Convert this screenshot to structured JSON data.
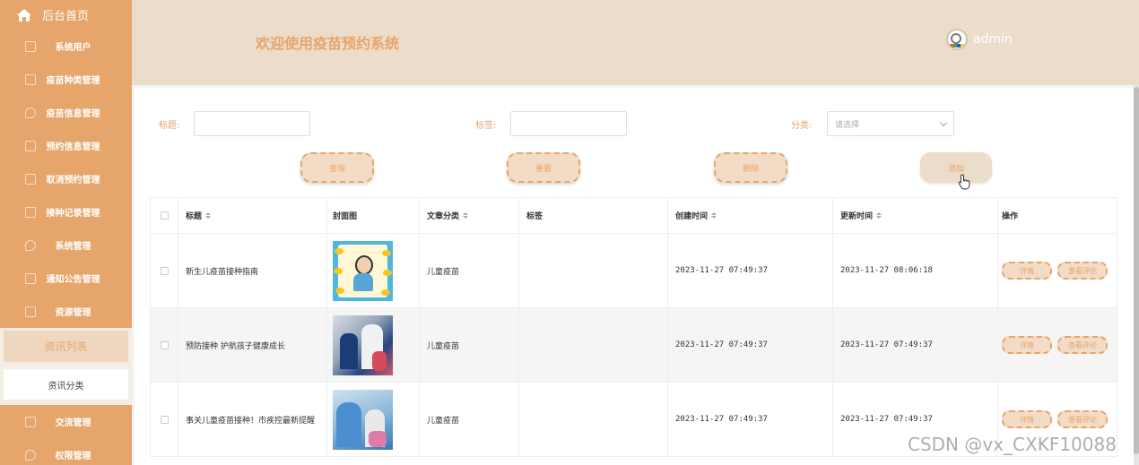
{
  "sidebar": {
    "home_label": "后台首页",
    "items": [
      {
        "label": "系统用户"
      },
      {
        "label": "疫苗种类管理"
      },
      {
        "label": "疫苗信息管理"
      },
      {
        "label": "预约信息管理"
      },
      {
        "label": "取消预约管理"
      },
      {
        "label": "接种记录管理"
      },
      {
        "label": "系统管理"
      },
      {
        "label": "通知公告管理"
      },
      {
        "label": "资源管理"
      }
    ],
    "sub_items": [
      {
        "label": "资讯列表",
        "active": true
      },
      {
        "label": "资讯分类",
        "active": false
      }
    ],
    "bottom_items": [
      {
        "label": "交流管理"
      },
      {
        "label": "权限管理"
      }
    ]
  },
  "header": {
    "title": "欢迎使用疫苗预约系统",
    "username": "admin"
  },
  "filters": {
    "title_label": "标题:",
    "tag_label": "标签:",
    "category_label": "分类:",
    "category_placeholder": "请选择"
  },
  "buttons": {
    "query": "查询",
    "reset": "重置",
    "delete": "删除",
    "add": "添加"
  },
  "table": {
    "headers": {
      "title": "标题",
      "cover": "封面图",
      "category": "文章分类",
      "tag": "标签",
      "created": "创建时间",
      "updated": "更新时间",
      "actions": "操作"
    },
    "rows": [
      {
        "title": "新生儿疫苗接种指南",
        "category": "儿童疫苗",
        "tag": "",
        "created": "2023-11-27 07:49:37",
        "updated": "2023-11-27 08:06:18"
      },
      {
        "title": "预防接种 护航孩子健康成长",
        "category": "儿童疫苗",
        "tag": "",
        "created": "2023-11-27 07:49:37",
        "updated": "2023-11-27 07:49:37"
      },
      {
        "title": "事关儿童疫苗接种！市疾控最新提醒",
        "category": "儿童疫苗",
        "tag": "",
        "created": "2023-11-27 07:49:37",
        "updated": "2023-11-27 07:49:37"
      }
    ],
    "row_actions": {
      "detail": "详情",
      "comments": "查看评论"
    }
  },
  "watermark": "CSDN @vx_CXKF10088",
  "colors": {
    "sidebar_bg": "#e6a56a",
    "header_bg": "#ecdcca",
    "accent": "#e6a56a"
  }
}
